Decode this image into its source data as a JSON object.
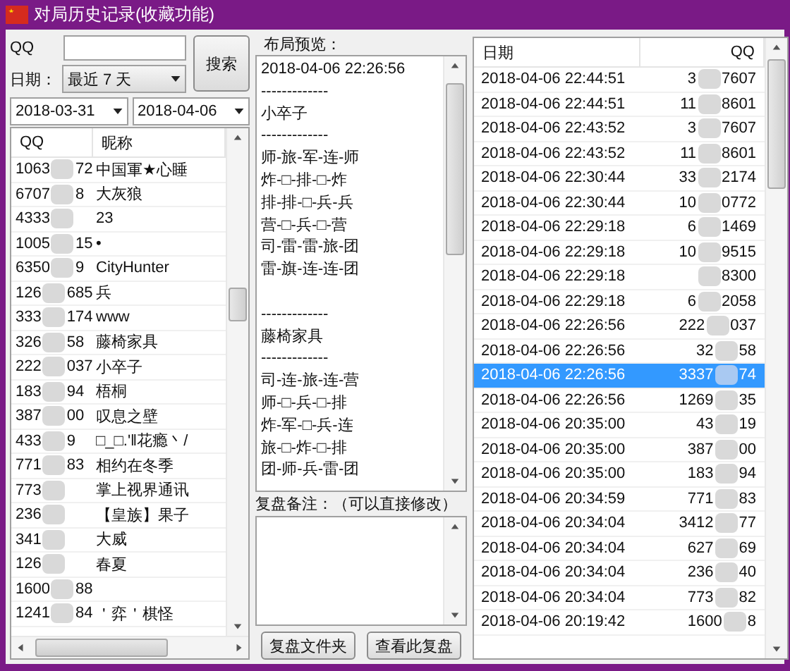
{
  "window": {
    "title": "对局历史记录(收藏功能)"
  },
  "search": {
    "qq_label": "QQ",
    "date_label": "日期：",
    "range": "最近 7 天",
    "button": "搜索",
    "from": "2018-03-31",
    "to": "2018-04-06"
  },
  "players": {
    "columns": [
      "QQ",
      "昵称"
    ],
    "rows": [
      {
        "qq_start": "1063",
        "qq_end": "72",
        "nickname": "中国軍★心睡"
      },
      {
        "qq_start": "6707",
        "qq_end": "8",
        "nickname": "大灰狼"
      },
      {
        "qq_start": "4333",
        "nickname": "23"
      },
      {
        "qq_start": "1005",
        "qq_end": "15",
        "nickname": "•"
      },
      {
        "qq_start": "6350",
        "qq_end": "9",
        "nickname": "CityHunter"
      },
      {
        "qq_start": "126",
        "qq_end": "685",
        "nickname": "兵"
      },
      {
        "qq_start": "333",
        "qq_end": "174",
        "nickname": "www"
      },
      {
        "qq_start": "326",
        "qq_end": "58",
        "nickname": "藤椅家具"
      },
      {
        "qq_start": "222",
        "qq_end": "037",
        "nickname": "小卒子"
      },
      {
        "qq_start": "183",
        "qq_end": "94",
        "nickname": "梧桐"
      },
      {
        "qq_start": "387",
        "qq_end": "00",
        "nickname": "叹息之壁"
      },
      {
        "qq_start": "433",
        "qq_end": "9",
        "nickname": "□_□.'‖花瘾丶/"
      },
      {
        "qq_start": "771",
        "qq_end": "83",
        "nickname": "相约在冬季"
      },
      {
        "qq_start": "773",
        "nickname": "掌上视界通讯"
      },
      {
        "qq_start": "236",
        "nickname": "【皇族】果子"
      },
      {
        "qq_start": "341",
        "nickname": "大威"
      },
      {
        "qq_start": "126",
        "nickname": "春夏"
      },
      {
        "qq_start": "1600",
        "qq_end": "88"
      },
      {
        "qq_start": "1241",
        "qq_end": "84",
        "nickname": "＇弈＇棋怪"
      }
    ]
  },
  "preview": {
    "label": "布局预览：",
    "lines": [
      {
        "kind": "text",
        "text": "2018-04-06 22:26:56"
      },
      {
        "kind": "text",
        "text": "-------------"
      },
      {
        "kind": "text",
        "text": "小卒子"
      },
      {
        "kind": "text",
        "text": "-------------"
      },
      {
        "kind": "text",
        "text": "师-旅-军-连-师"
      },
      {
        "kind": "text",
        "text": "炸-□-排-□-炸"
      },
      {
        "kind": "text",
        "text": "排-排-□-兵-兵"
      },
      {
        "kind": "text",
        "text": "营-□-兵-□-营"
      },
      {
        "kind": "text",
        "text": "司-雷-雷-旅-团"
      },
      {
        "kind": "text",
        "text": "雷-旗-连-连-团"
      },
      {
        "kind": "blank"
      },
      {
        "kind": "text",
        "text": "-------------"
      },
      {
        "kind": "text",
        "text": "藤椅家具"
      },
      {
        "kind": "text",
        "text": "-------------"
      },
      {
        "kind": "text",
        "text": "司-连-旅-连-营"
      },
      {
        "kind": "text",
        "text": "师-□-兵-□-排"
      },
      {
        "kind": "text",
        "text": "炸-军-□-兵-连"
      },
      {
        "kind": "text",
        "text": "旅-□-炸-□-排"
      },
      {
        "kind": "text",
        "text": "团-师-兵-雷-团"
      }
    ]
  },
  "notes": {
    "label": "复盘备注：（可以直接修改）"
  },
  "buttons": [
    "复盘文件夹",
    "查看此复盘"
  ],
  "games": {
    "columns": [
      "日期",
      "QQ"
    ],
    "rows": [
      {
        "date": "2018-04-06 22:44:51",
        "qq_start": "3",
        "qq_end": "7607",
        "selected": false
      },
      {
        "date": "2018-04-06 22:44:51",
        "qq_start": "11",
        "qq_end": "8601",
        "selected": false
      },
      {
        "date": "2018-04-06 22:43:52",
        "qq_start": "3",
        "qq_end": "7607",
        "selected": false
      },
      {
        "date": "2018-04-06 22:43:52",
        "qq_start": "11",
        "qq_end": "8601",
        "selected": false
      },
      {
        "date": "2018-04-06 22:30:44",
        "qq_start": "33",
        "qq_end": "2174",
        "selected": false
      },
      {
        "date": "2018-04-06 22:30:44",
        "qq_start": "10",
        "qq_end": "0772",
        "selected": false
      },
      {
        "date": "2018-04-06 22:29:18",
        "qq_start": "6",
        "qq_end": "1469",
        "selected": false
      },
      {
        "date": "2018-04-06 22:29:18",
        "qq_start": "10",
        "qq_end": "9515",
        "selected": false
      },
      {
        "date": "2018-04-06 22:29:18",
        "qq_end": "8300",
        "selected": false
      },
      {
        "date": "2018-04-06 22:29:18",
        "qq_start": "6",
        "qq_end": "2058",
        "selected": false
      },
      {
        "date": "2018-04-06 22:26:56",
        "qq_start": "222",
        "qq_end": "037",
        "selected": false
      },
      {
        "date": "2018-04-06 22:26:56",
        "qq_start": "32",
        "qq_end": "58",
        "selected": false
      },
      {
        "date": "2018-04-06 22:26:56",
        "qq_start": "3337",
        "qq_end": "74",
        "selected": true
      },
      {
        "date": "2018-04-06 22:26:56",
        "qq_start": "1269",
        "qq_end": "35",
        "selected": false
      },
      {
        "date": "2018-04-06 20:35:00",
        "qq_start": "43",
        "qq_end": "19",
        "selected": false
      },
      {
        "date": "2018-04-06 20:35:00",
        "qq_start": "387",
        "qq_end": "00",
        "selected": false
      },
      {
        "date": "2018-04-06 20:35:00",
        "qq_start": "183",
        "qq_end": "94",
        "selected": false
      },
      {
        "date": "2018-04-06 20:34:59",
        "qq_start": "771",
        "qq_end": "83",
        "selected": false
      },
      {
        "date": "2018-04-06 20:34:04",
        "qq_start": "3412",
        "qq_end": "77",
        "selected": false
      },
      {
        "date": "2018-04-06 20:34:04",
        "qq_start": "627",
        "qq_end": "69",
        "selected": false
      },
      {
        "date": "2018-04-06 20:34:04",
        "qq_start": "236",
        "qq_end": "40",
        "selected": false
      },
      {
        "date": "2018-04-06 20:34:04",
        "qq_start": "773",
        "qq_end": "82",
        "selected": false
      },
      {
        "date": "2018-04-06 20:19:42",
        "qq_start": "1600",
        "qq_end": "8",
        "selected": false
      }
    ]
  }
}
